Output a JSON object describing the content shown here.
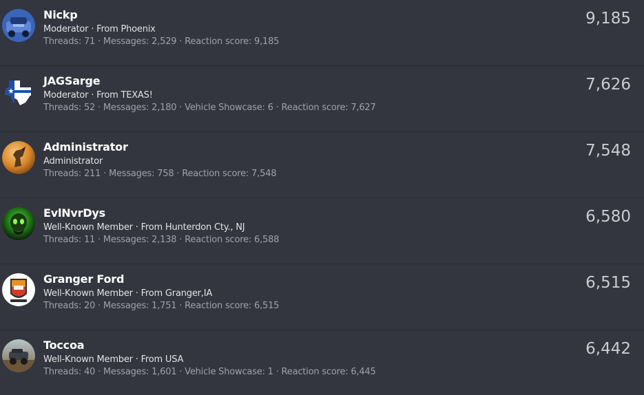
{
  "members": [
    {
      "name": "Nickp",
      "title": "Moderator · From Phoenix",
      "stats": "Threads: 71 · Messages: 2,529 · Reaction score: 9,185",
      "score": "9,185",
      "avatar_icon": "blue-truck-avatar-icon"
    },
    {
      "name": "JAGSarge",
      "title": "Moderator · From TEXAS!",
      "stats": "Threads: 52 · Messages: 2,180 · Vehicle Showcase: 6 · Reaction score: 7,627",
      "score": "7,626",
      "avatar_icon": "texas-flag-avatar-icon"
    },
    {
      "name": "Administrator",
      "title": "Administrator",
      "stats": "Threads: 211 · Messages: 758 · Reaction score: 7,548",
      "score": "7,548",
      "avatar_icon": "bronco-horse-avatar-icon"
    },
    {
      "name": "EvlNvrDys",
      "title": "Well-Known Member · From Hunterdon Cty., NJ",
      "stats": "Threads: 11 · Messages: 2,138 · Reaction score: 6,588",
      "score": "6,580",
      "avatar_icon": "green-skull-avatar-icon"
    },
    {
      "name": "Granger Ford",
      "title": "Well-Known Member · From Granger,IA",
      "stats": "Threads: 20 · Messages: 1,751 · Reaction score: 6,515",
      "score": "6,515",
      "avatar_icon": "ford-badge-avatar-icon"
    },
    {
      "name": "Toccoa",
      "title": "Well-Known Member · From USA",
      "stats": "Threads: 40 · Messages: 1,601 · Vehicle Showcase: 1 · Reaction score: 6,445",
      "score": "6,442",
      "avatar_icon": "offroad-truck-avatar-icon"
    }
  ]
}
